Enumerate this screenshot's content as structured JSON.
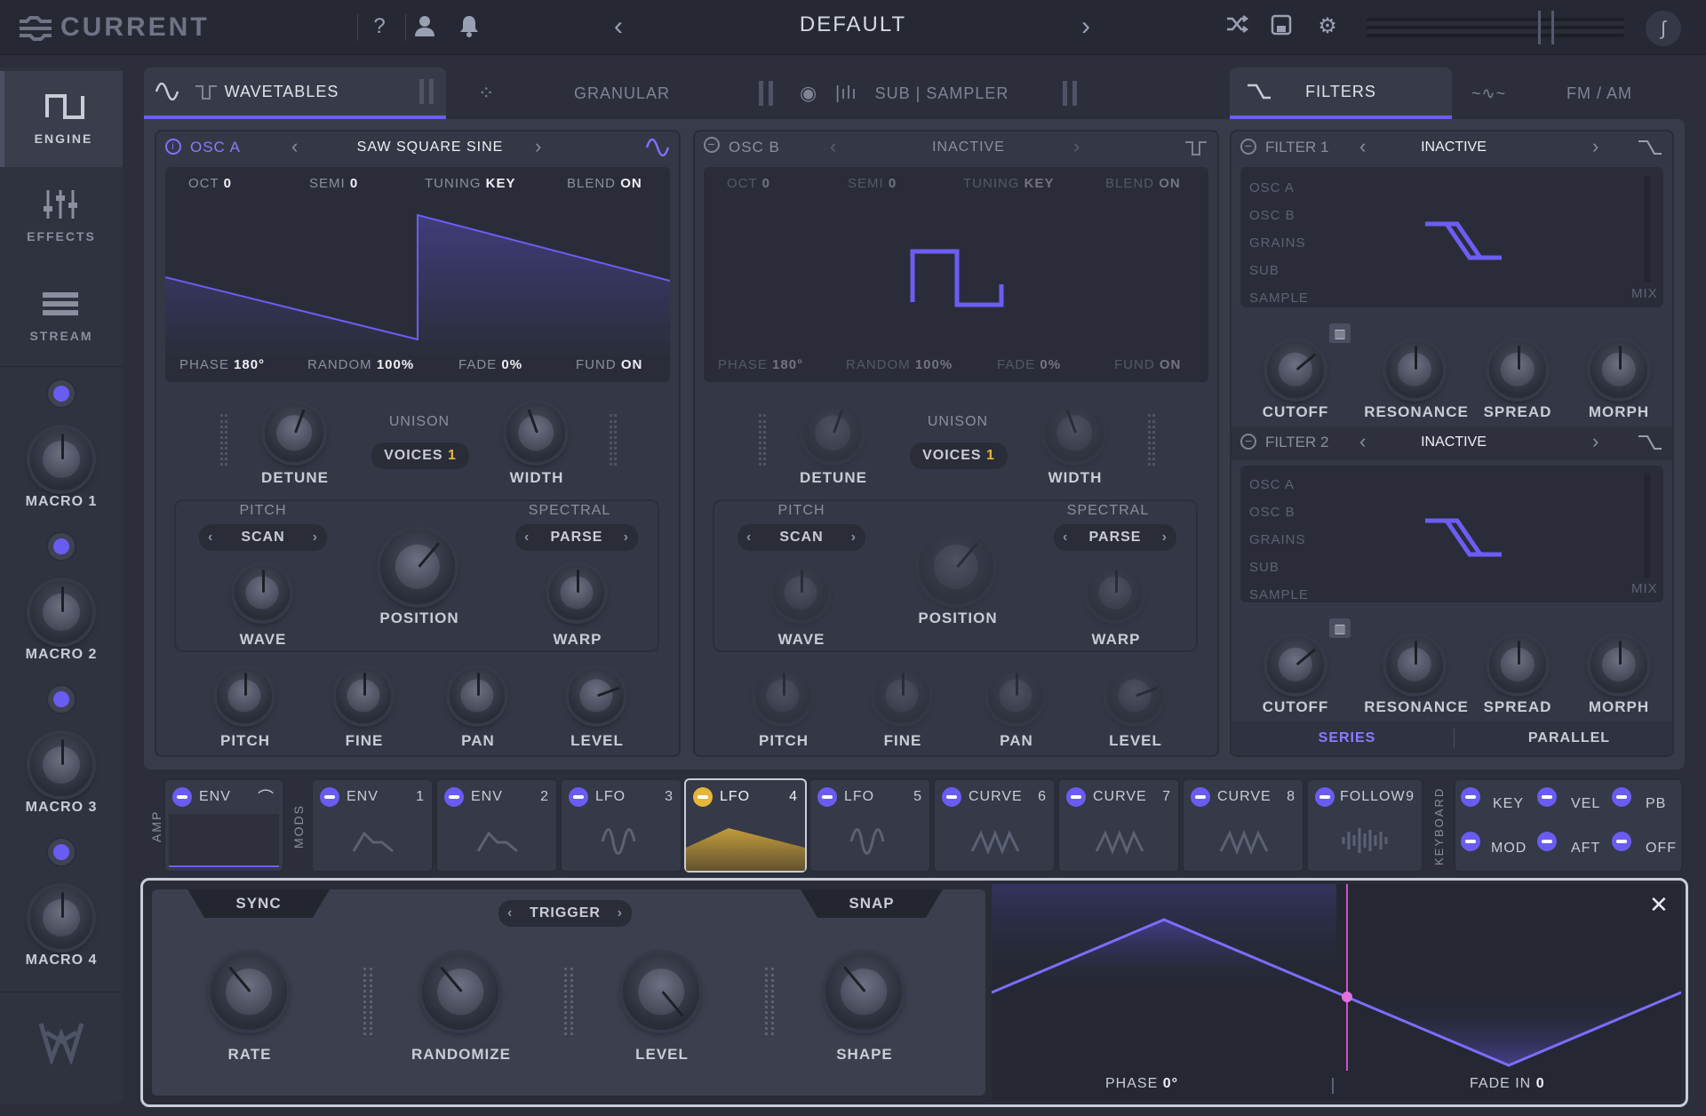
{
  "app": {
    "name": "CURRENT",
    "preset": "DEFAULT"
  },
  "sidebar": {
    "items": [
      {
        "label": "ENGINE",
        "icon": "engine-wave-icon"
      },
      {
        "label": "EFFECTS",
        "icon": "sliders-icon"
      },
      {
        "label": "STREAM",
        "icon": "stream-icon"
      }
    ],
    "macros": [
      "MACRO 1",
      "MACRO 2",
      "MACRO 3",
      "MACRO 4"
    ]
  },
  "tabs": {
    "wavetables": "WAVETABLES",
    "granular": "GRANULAR",
    "sub_sampler": "SUB | SAMPLER",
    "filters": "FILTERS",
    "fm_am": "FM / AM"
  },
  "osc_a": {
    "title": "OSC A",
    "wave": "SAW SQUARE SINE",
    "oct_l": "OCT",
    "oct": "0",
    "semi_l": "SEMI",
    "semi": "0",
    "tuning_l": "TUNING",
    "tuning": "KEY",
    "blend_l": "BLEND",
    "blend": "ON",
    "phase_l": "PHASE",
    "phase": "180°",
    "random_l": "RANDOM",
    "random": "100%",
    "fade_l": "FADE",
    "fade": "0%",
    "fund_l": "FUND",
    "fund": "ON",
    "unison": "UNISON",
    "voices_l": "VOICES",
    "voices": "1",
    "detune": "DETUNE",
    "width": "WIDTH",
    "pitch_h": "PITCH",
    "scan": "SCAN",
    "spectral_h": "SPECTRAL",
    "parse": "PARSE",
    "wave_k": "WAVE",
    "position": "POSITION",
    "warp": "WARP",
    "pitch": "PITCH",
    "fine": "FINE",
    "pan": "PAN",
    "level": "LEVEL"
  },
  "osc_b": {
    "title": "OSC B",
    "wave": "INACTIVE",
    "oct_l": "OCT",
    "oct": "0",
    "semi_l": "SEMI",
    "semi": "0",
    "tuning_l": "TUNING",
    "tuning": "KEY",
    "blend_l": "BLEND",
    "blend": "ON",
    "phase_l": "PHASE",
    "phase": "180°",
    "random_l": "RANDOM",
    "random": "100%",
    "fade_l": "FADE",
    "fade": "0%",
    "fund_l": "FUND",
    "fund": "ON",
    "unison": "UNISON",
    "voices_l": "VOICES",
    "voices": "1",
    "detune": "DETUNE",
    "width": "WIDTH",
    "pitch_h": "PITCH",
    "scan": "SCAN",
    "spectral_h": "SPECTRAL",
    "parse": "PARSE",
    "wave_k": "WAVE",
    "position": "POSITION",
    "warp": "WARP",
    "pitch": "PITCH",
    "fine": "FINE",
    "pan": "PAN",
    "level": "LEVEL"
  },
  "filter1": {
    "title": "FILTER 1",
    "state": "INACTIVE",
    "sources": [
      "OSC A",
      "OSC B",
      "GRAINS",
      "SUB",
      "SAMPLE"
    ],
    "mix": "MIX",
    "cutoff": "CUTOFF",
    "resonance": "RESONANCE",
    "spread": "SPREAD",
    "morph": "MORPH"
  },
  "filter2": {
    "title": "FILTER 2",
    "state": "INACTIVE",
    "sources": [
      "OSC A",
      "OSC B",
      "GRAINS",
      "SUB",
      "SAMPLE"
    ],
    "mix": "MIX",
    "cutoff": "CUTOFF",
    "resonance": "RESONANCE",
    "spread": "SPREAD",
    "morph": "MORPH"
  },
  "routing": {
    "series": "SERIES",
    "parallel": "PARALLEL"
  },
  "mods": {
    "amp_label": "AMP",
    "mods_label": "MODS",
    "keyboard_label": "KEYBOARD",
    "amp": {
      "name": "ENV"
    },
    "slots": [
      {
        "name": "ENV",
        "num": "1"
      },
      {
        "name": "ENV",
        "num": "2"
      },
      {
        "name": "LFO",
        "num": "3"
      },
      {
        "name": "LFO",
        "num": "4"
      },
      {
        "name": "LFO",
        "num": "5"
      },
      {
        "name": "CURVE",
        "num": "6"
      },
      {
        "name": "CURVE",
        "num": "7"
      },
      {
        "name": "CURVE",
        "num": "8"
      },
      {
        "name": "FOLLOW",
        "num": "9"
      }
    ],
    "keyboard": [
      "KEY",
      "VEL",
      "PB",
      "MOD",
      "AFT",
      "OFF"
    ]
  },
  "lfo_editor": {
    "sync": "SYNC",
    "trigger": "TRIGGER",
    "snap": "SNAP",
    "rate": "RATE",
    "randomize": "RANDOMIZE",
    "level": "LEVEL",
    "shape": "SHAPE",
    "phase_l": "PHASE",
    "phase": "0°",
    "fade_l": "FADE IN",
    "fade": "0"
  },
  "colors": {
    "accent": "#6d5df4",
    "active_lfo": "#e5b63a",
    "bg": "#2c2f3b"
  }
}
